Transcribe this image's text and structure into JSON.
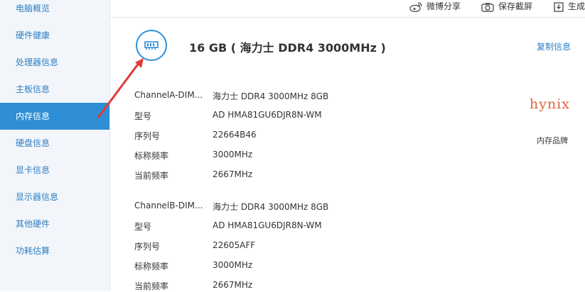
{
  "sidebar": {
    "items": [
      {
        "label": "电脑概览"
      },
      {
        "label": "硬件健康"
      },
      {
        "label": "处理器信息"
      },
      {
        "label": "主板信息"
      },
      {
        "label": "内存信息"
      },
      {
        "label": "硬盘信息"
      },
      {
        "label": "显卡信息"
      },
      {
        "label": "显示器信息"
      },
      {
        "label": "其他硬件"
      },
      {
        "label": "功耗估算"
      }
    ],
    "active_index": 4
  },
  "toolbar": {
    "weibo_share": "微博分享",
    "save_screenshot": "保存截屏",
    "generate": "生成"
  },
  "memory": {
    "title": "16 GB ( 海力士 DDR4 3000MHz )",
    "copy_label": "复制信息",
    "slots": [
      {
        "rows": [
          {
            "label": "ChannelA-DIM...",
            "value": "海力士 DDR4 3000MHz 8GB"
          },
          {
            "label": "型号",
            "value": "AD HMA81GU6DJR8N-WM"
          },
          {
            "label": "序列号",
            "value": "22664B46"
          },
          {
            "label": "标称频率",
            "value": "3000MHz"
          },
          {
            "label": "当前频率",
            "value": "2667MHz"
          }
        ]
      },
      {
        "rows": [
          {
            "label": "ChannelB-DIM...",
            "value": "海力士 DDR4 3000MHz 8GB"
          },
          {
            "label": "型号",
            "value": "AD HMA81GU6DJR8N-WM"
          },
          {
            "label": "序列号",
            "value": "22605AFF"
          },
          {
            "label": "标称频率",
            "value": "3000MHz"
          },
          {
            "label": "当前频率",
            "value": "2667MHz"
          }
        ]
      }
    ]
  },
  "brand": {
    "logo_text": "hynix",
    "caption": "内存品牌"
  },
  "colors": {
    "accent": "#2f8fd6",
    "link": "#2f7ec2",
    "brand": "#e3603a",
    "annotation_arrow": "#e03a3a"
  }
}
